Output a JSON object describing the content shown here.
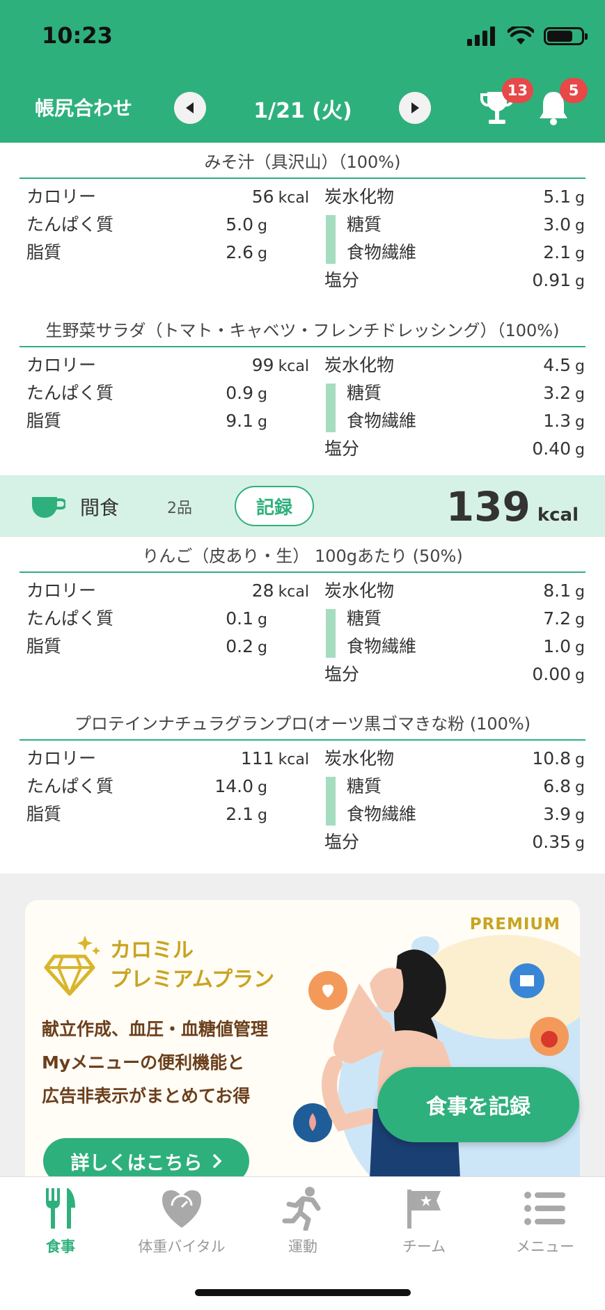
{
  "status_bar": {
    "time": "10:23"
  },
  "header": {
    "title": "帳尻合わせ",
    "date": "1/21 (火)",
    "trophy_badge": "13",
    "bell_badge": "5",
    "colors": {
      "primary": "#2eb07c",
      "badge": "#e74848"
    }
  },
  "foods": [
    {
      "title": "みそ汁（具沢山）（100%)",
      "calorie_label": "カロリー",
      "calorie": "56",
      "calorie_unit": "kcal",
      "protein_label": "たんぱく質",
      "protein": "5.0",
      "protein_unit": "g",
      "fat_label": "脂質",
      "fat": "2.6",
      "fat_unit": "g",
      "carb_label": "炭水化物",
      "carb": "5.1",
      "carb_unit": "g",
      "sugar_label": "糖質",
      "sugar": "3.0",
      "sugar_unit": "g",
      "fiber_label": "食物繊維",
      "fiber": "2.1",
      "fiber_unit": "g",
      "salt_label": "塩分",
      "salt": "0.91",
      "salt_unit": "g"
    },
    {
      "title": "生野菜サラダ（トマト・キャベツ・フレンチドレッシング）（100%)",
      "calorie_label": "カロリー",
      "calorie": "99",
      "calorie_unit": "kcal",
      "protein_label": "たんぱく質",
      "protein": "0.9",
      "protein_unit": "g",
      "fat_label": "脂質",
      "fat": "9.1",
      "fat_unit": "g",
      "carb_label": "炭水化物",
      "carb": "4.5",
      "carb_unit": "g",
      "sugar_label": "糖質",
      "sugar": "3.2",
      "sugar_unit": "g",
      "fiber_label": "食物繊維",
      "fiber": "1.3",
      "fiber_unit": "g",
      "salt_label": "塩分",
      "salt": "0.40",
      "salt_unit": "g"
    },
    {
      "title": "りんご（皮あり・生） 100gあたり (50%)",
      "calorie_label": "カロリー",
      "calorie": "28",
      "calorie_unit": "kcal",
      "protein_label": "たんぱく質",
      "protein": "0.1",
      "protein_unit": "g",
      "fat_label": "脂質",
      "fat": "0.2",
      "fat_unit": "g",
      "carb_label": "炭水化物",
      "carb": "8.1",
      "carb_unit": "g",
      "sugar_label": "糖質",
      "sugar": "7.2",
      "sugar_unit": "g",
      "fiber_label": "食物繊維",
      "fiber": "1.0",
      "fiber_unit": "g",
      "salt_label": "塩分",
      "salt": "0.00",
      "salt_unit": "g"
    },
    {
      "title": "プロテインナチュラグランプロ(オーツ黒ゴマきな粉 (100%)",
      "calorie_label": "カロリー",
      "calorie": "111",
      "calorie_unit": "kcal",
      "protein_label": "たんぱく質",
      "protein": "14.0",
      "protein_unit": "g",
      "fat_label": "脂質",
      "fat": "2.1",
      "fat_unit": "g",
      "carb_label": "炭水化物",
      "carb": "10.8",
      "carb_unit": "g",
      "sugar_label": "糖質",
      "sugar": "6.8",
      "sugar_unit": "g",
      "fiber_label": "食物繊維",
      "fiber": "3.9",
      "fiber_unit": "g",
      "salt_label": "塩分",
      "salt": "0.35",
      "salt_unit": "g"
    }
  ],
  "snack": {
    "label": "間食",
    "count": "2品",
    "record_button": "記録",
    "kcal": "139",
    "kcal_unit": "kcal",
    "background": "#d6f2e6"
  },
  "banner": {
    "premium_tag": "PREMIUM",
    "title_line1": "カロミル",
    "title_line2": "プレミアムプラン",
    "text_line1": "献立作成、血圧・血糖値管理",
    "text_line2": "Myメニューの便利機能と",
    "text_line3": "広告非表示がまとめてお得",
    "details_button": "詳しくはこちら",
    "accent_color": "#c9a422"
  },
  "fab": {
    "label": "食事を記録"
  },
  "tabbar": {
    "tabs": [
      {
        "label": "食事",
        "icon": "fork-knife-icon",
        "active": true
      },
      {
        "label": "体重バイタル",
        "icon": "heart-scale-icon",
        "active": false
      },
      {
        "label": "運動",
        "icon": "runner-icon",
        "active": false
      },
      {
        "label": "チーム",
        "icon": "flag-icon",
        "active": false
      },
      {
        "label": "メニュー",
        "icon": "list-icon",
        "active": false
      }
    ]
  }
}
